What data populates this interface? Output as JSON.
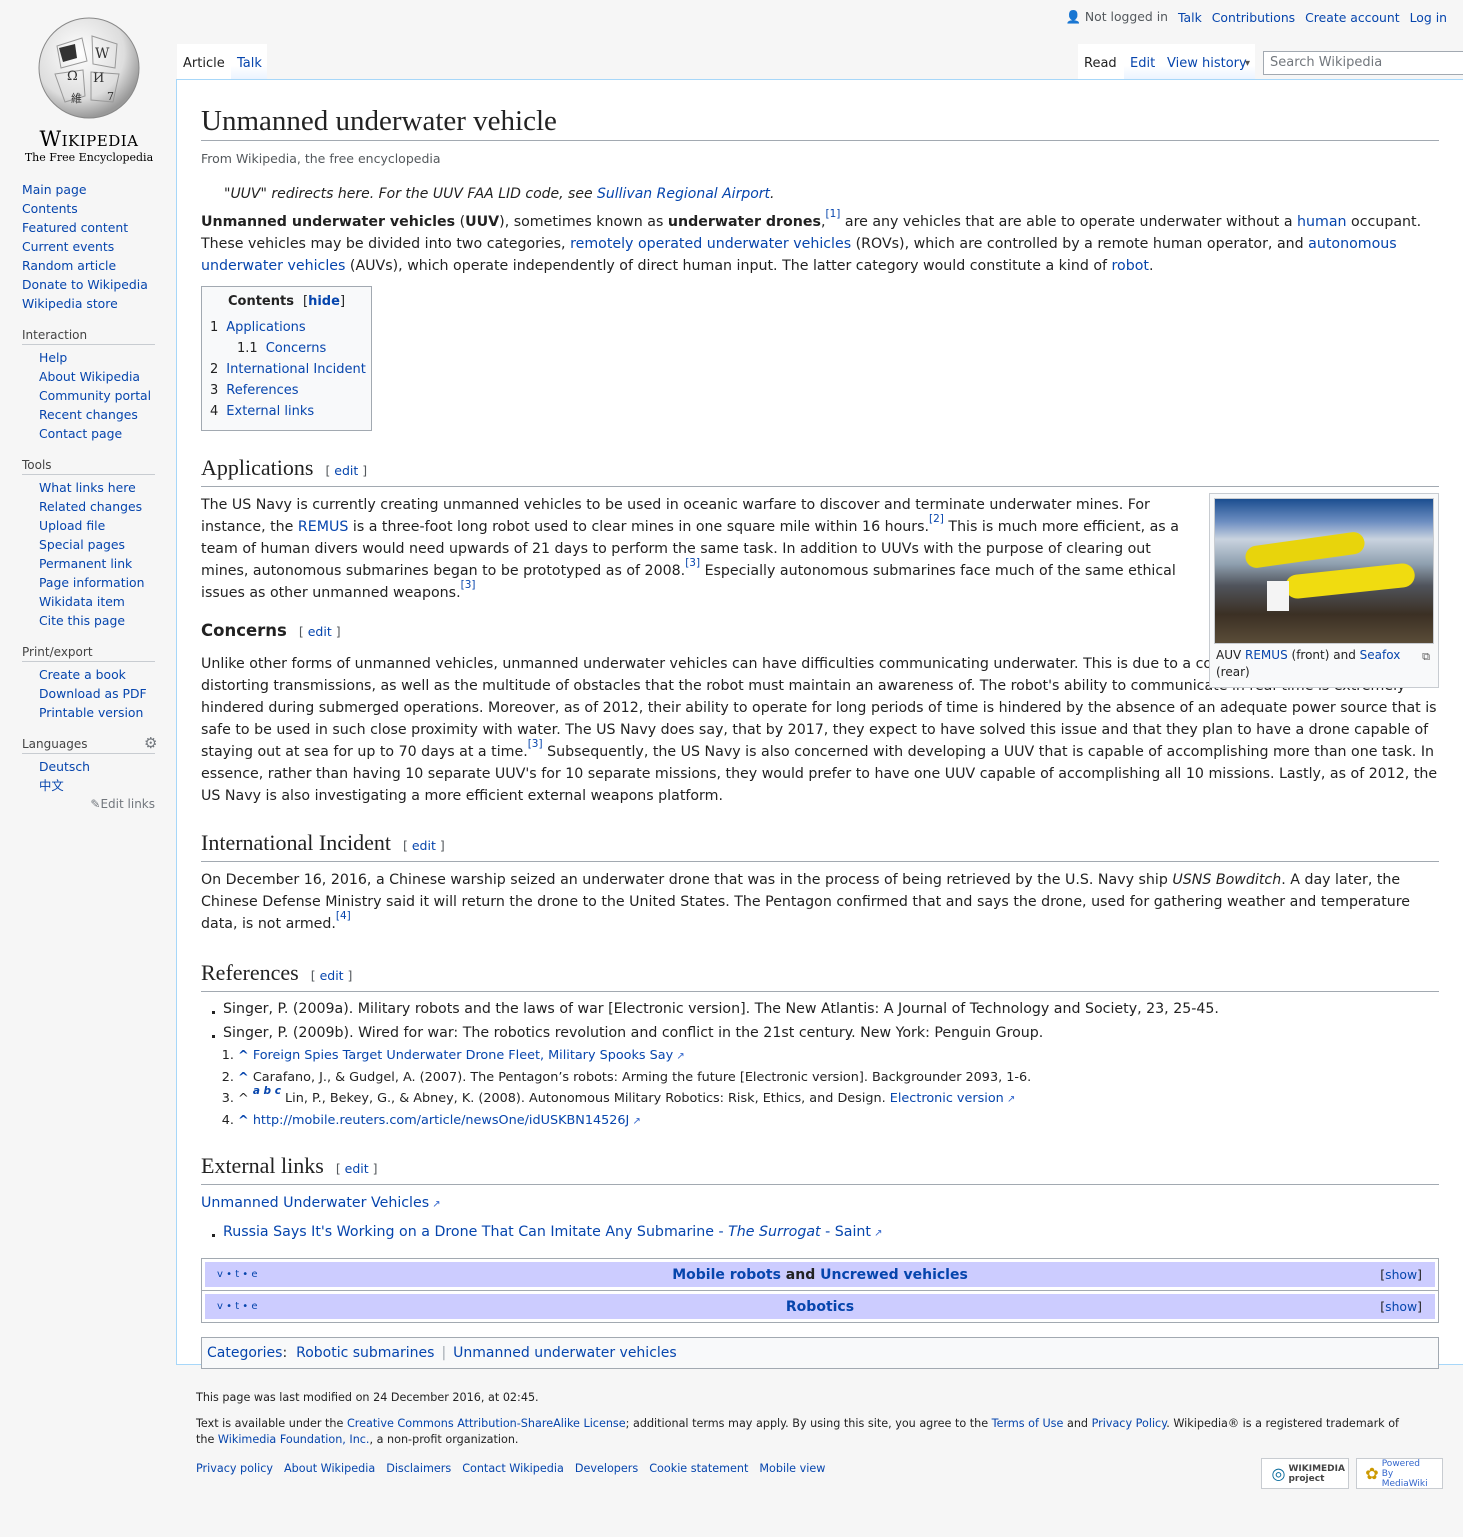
{
  "logo": {
    "wordmark": "Wikipedia",
    "tagline": "The Free Encyclopedia"
  },
  "personal": {
    "not_logged_in": "Not logged in",
    "talk": "Talk",
    "contributions": "Contributions",
    "create_account": "Create account",
    "log_in": "Log in"
  },
  "tabs": {
    "article": "Article",
    "talk": "Talk",
    "read": "Read",
    "edit": "Edit",
    "view_history": "View history"
  },
  "search": {
    "placeholder": "Search Wikipedia"
  },
  "sidebar": {
    "nav": [
      "Main page",
      "Contents",
      "Featured content",
      "Current events",
      "Random article",
      "Donate to Wikipedia",
      "Wikipedia store"
    ],
    "interaction": {
      "heading": "Interaction",
      "items": [
        "Help",
        "About Wikipedia",
        "Community portal",
        "Recent changes",
        "Contact page"
      ]
    },
    "tools": {
      "heading": "Tools",
      "items": [
        "What links here",
        "Related changes",
        "Upload file",
        "Special pages",
        "Permanent link",
        "Page information",
        "Wikidata item",
        "Cite this page"
      ]
    },
    "print": {
      "heading": "Print/export",
      "items": [
        "Create a book",
        "Download as PDF",
        "Printable version"
      ]
    },
    "languages": {
      "heading": "Languages",
      "items": [
        "Deutsch",
        "中文"
      ],
      "edit_links": "Edit links"
    }
  },
  "article": {
    "title": "Unmanned underwater vehicle",
    "from": "From Wikipedia, the free encyclopedia",
    "hatnote": {
      "pre": "\"UUV\" redirects here. For the UUV FAA LID code, see ",
      "link": "Sullivan Regional Airport",
      "post": "."
    },
    "lead": {
      "b1": "Unmanned underwater vehicles",
      "t1": " (",
      "b2": "UUV",
      "t2": "), sometimes known as ",
      "b3": "underwater drones",
      "t3": ",",
      "r1": "[1]",
      "t4": " are any vehicles that are able to operate underwater without a ",
      "l1": "human",
      "t5": " occupant. These vehicles may be divided into two categories, ",
      "l2": "remotely operated underwater vehicles",
      "t6": " (ROVs), which are controlled by a remote human operator, and ",
      "l3": "autonomous underwater vehicles",
      "t7": " (AUVs), which operate independently of direct human input. The latter category would constitute a kind of ",
      "l4": "robot",
      "t8": "."
    },
    "toc": {
      "title": "Contents",
      "hide": "hide",
      "items": [
        {
          "num": "1",
          "label": "Applications"
        },
        {
          "num": "1.1",
          "label": "Concerns"
        },
        {
          "num": "2",
          "label": "International Incident"
        },
        {
          "num": "3",
          "label": "References"
        },
        {
          "num": "4",
          "label": "External links"
        }
      ]
    },
    "edit": "edit",
    "applications": {
      "heading": "Applications",
      "t1": "The US Navy is currently creating unmanned vehicles to be used in oceanic warfare to discover and terminate underwater mines. For instance, the ",
      "l1": "REMUS",
      "t2": " is a three-foot long robot used to clear mines in one square mile within 16 hours.",
      "r1": "[2]",
      "t3": " This is much more efficient, as a team of human divers would need upwards of 21 days to perform the same task. In addition to UUVs with the purpose of clearing out mines, autonomous submarines began to be prototyped as of 2008.",
      "r2": "[3]",
      "t4": " Especially autonomous submarines face much of the same ethical issues as other unmanned weapons.",
      "r3": "[3]"
    },
    "figure": {
      "t1": "AUV ",
      "l1": "REMUS",
      "t2": " (front) and ",
      "l2": "Seafox",
      "t3": " (rear)"
    },
    "concerns": {
      "heading": "Concerns",
      "t1": "Unlike other forms of unmanned vehicles, unmanned underwater vehicles can have difficulties communicating underwater. This is due to a combination of the water distorting transmissions, as well as the multitude of obstacles that the robot must maintain an awareness of. The robot's ability to communicate in real-time is extremely hindered during submerged operations. Moreover, as of 2012, their ability to operate for long periods of time is hindered by the absence of an adequate power source that is safe to be used in such close proximity with water. The US Navy does say, that by 2017, they expect to have solved this issue and that they plan to have a drone capable of staying out at sea for up to 70 days at a time.",
      "r1": "[3]",
      "t2": " Subsequently, the US Navy is also concerned with developing a UUV that is capable of accomplishing more than one task. In essence, rather than having 10 separate UUV's for 10 separate missions, they would prefer to have one UUV capable of accomplishing all 10 missions. Lastly, as of 2012, the US Navy is also investigating a more efficient external weapons platform."
    },
    "incident": {
      "heading": "International Incident",
      "t1": "On December 16, 2016, a Chinese warship seized an underwater drone that was in the process of being retrieved by the U.S. Navy ship ",
      "i1": "USNS Bowditch",
      "t2": ". A day later, the Chinese Defense Ministry said it will return the drone to the United States. The Pentagon confirmed that and says the drone, used for gathering weather and temperature data, is not armed.",
      "r1": "[4]"
    },
    "references": {
      "heading": "References",
      "bullets": [
        "Singer, P. (2009a). Military robots and the laws of war [Electronic version]. The New Atlantis: A Journal of Technology and Society, 23, 25-45.",
        "Singer, P. (2009b). Wired for war: The robotics revolution and conflict in the 21st century. New York: Penguin Group."
      ],
      "n1": "Foreign Spies Target Underwater Drone Fleet, Military Spooks Say",
      "n2": "Carafano, J., & Gudgel, A. (2007). The Pentagon’s robots: Arming the future [Electronic version]. Backgrounder 2093, 1-6.",
      "n3_abc": "a b c",
      "n3": "Lin, P., Bekey, G., & Abney, K. (2008). Autonomous Military Robotics: Risk, Ethics, and Design. ",
      "n3_link": "Electronic version",
      "n4": "http://mobile.reuters.com/article/newsOne/idUSKBN14526J",
      "caret": "^"
    },
    "external": {
      "heading": "External links",
      "l1": "Unmanned Underwater Vehicles",
      "b1_pre": "Russia Says It's Working on a Drone That Can Imitate Any Submarine - ",
      "b1_i": "The Surrogat",
      "b1_post": " - Saint"
    },
    "navboxes": {
      "vte": {
        "v": "v",
        "t": "t",
        "e": "e"
      },
      "row1": {
        "a": "Mobile robots",
        "and": " and ",
        "b": "Uncrewed vehicles"
      },
      "row2": "Robotics",
      "show": "show"
    },
    "categories": {
      "label": "Categories",
      "items": [
        "Robotic submarines",
        "Unmanned underwater vehicles"
      ]
    }
  },
  "footer": {
    "modified": "This page was last modified on 24 December 2016, at 02:45.",
    "l_pre": "Text is available under the ",
    "l_cc": "Creative Commons Attribution-ShareAlike License",
    "l_mid": "; additional terms may apply. By using this site, you agree to the ",
    "l_tou": "Terms of Use",
    "l_and": " and ",
    "l_pp": "Privacy Policy",
    "l_post": ". Wikipedia® is a registered trademark of the ",
    "l_wmf": "Wikimedia Foundation, Inc.",
    "l_end": ", a non-profit organization.",
    "links": [
      "Privacy policy",
      "About Wikipedia",
      "Disclaimers",
      "Contact Wikipedia",
      "Developers",
      "Cookie statement",
      "Mobile view"
    ],
    "badge1": "WIKIMEDIA project",
    "badge2": "Powered By MediaWiki"
  }
}
